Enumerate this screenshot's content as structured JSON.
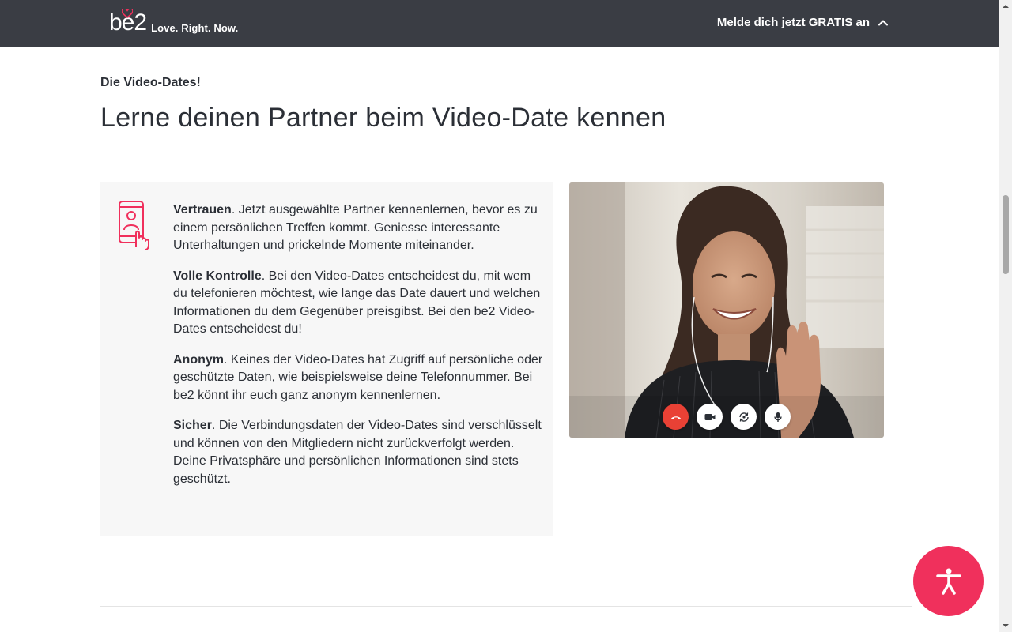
{
  "header": {
    "logo_text": "be2",
    "tagline": "Love. Right. Now.",
    "signup_label": "Melde dich jetzt GRATIS an"
  },
  "section": {
    "eyebrow": "Die Video-Dates!",
    "title": "Lerne deinen Partner beim Video-Date kennen"
  },
  "features": [
    {
      "title": "Vertrauen",
      "text": ". Jetzt ausgewählte Partner kennenlernen, bevor es zu einem persönlichen Treffen kommt. Geniesse interessante Unterhaltungen und prickelnde Momente miteinander."
    },
    {
      "title": "Volle Kontrolle",
      "text": ". Bei den Video-Dates entscheidest du, mit wem du telefonieren möchtest, wie lange das Date dauert und welchen Informationen du dem Gegenüber preisgibst. Bei den be2 Video-Dates entscheidest du!"
    },
    {
      "title": "Anonym",
      "text": ". Keines der Video-Dates hat Zugriff auf persönliche oder geschützte Daten, wie beispielsweise deine Telefonnummer. Bei be2 könnt ihr euch ganz anonym kennenlernen."
    },
    {
      "title": "Sicher",
      "text": ". Die Verbindungsdaten der Video-Dates sind verschlüsselt und können von den Mitgliedern nicht zurückverfolgt werden. Deine Privatsphäre und persönlichen Informationen sind stets geschützt."
    }
  ],
  "icons": {
    "feature_icon": "phone-video-icon",
    "controls": [
      "end-call-icon",
      "camera-icon",
      "switch-camera-icon",
      "microphone-icon"
    ],
    "accessibility": "accessibility-icon"
  },
  "colors": {
    "header_bg": "#3a3d44",
    "brand_pink": "#f0305c",
    "card_bg": "#f7f7f7",
    "end_call_red": "#e94135"
  }
}
